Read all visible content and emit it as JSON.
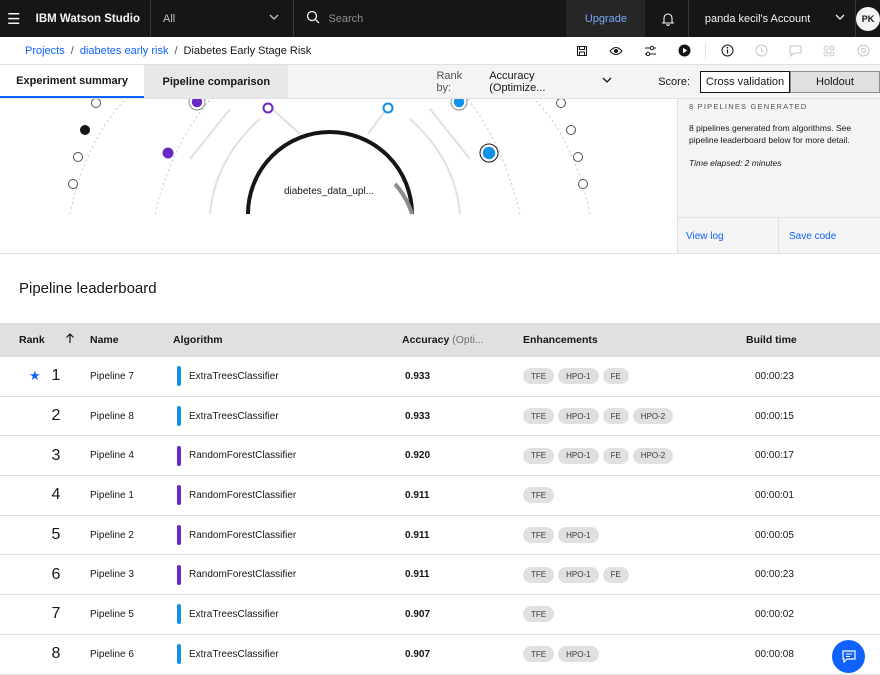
{
  "topbar": {
    "brand": "IBM Watson Studio",
    "scope_value": "All",
    "search_placeholder": "Search",
    "upgrade_label": "Upgrade",
    "account_label": "panda kecil's Account",
    "avatar_initials": "PK"
  },
  "breadcrumb": {
    "items": [
      "Projects",
      "diabetes early risk"
    ],
    "current": "Diabetes Early Stage Risk"
  },
  "tabs": [
    "Experiment summary",
    "Pipeline comparison"
  ],
  "rank_by": {
    "label": "Rank by:",
    "value": "Accuracy (Optimize..."
  },
  "score": {
    "label": "Score:",
    "options": [
      "Cross validation",
      "Holdout"
    ],
    "selected": "Cross validation"
  },
  "viz": {
    "center_label": "diabetes_data_upl..."
  },
  "side_panel": {
    "heading": "8 PIPELINES GENERATED",
    "description": "8 pipelines generated from algorithms. See pipeline leaderboard below for more detail.",
    "elapsed": "Time elapsed: 2 minutes",
    "view_log": "View log",
    "save_code": "Save code"
  },
  "leaderboard": {
    "title": "Pipeline leaderboard",
    "columns": {
      "rank": "Rank",
      "name": "Name",
      "algorithm": "Algorithm",
      "accuracy": "Accuracy",
      "accuracy_suffix": "(Opti...",
      "enhancements": "Enhancements",
      "build_time": "Build time"
    },
    "rows": [
      {
        "rank": "1",
        "name": "Pipeline 7",
        "algorithm": "ExtraTreesClassifier",
        "color": "#1192e8",
        "accuracy": "0.933",
        "enh": [
          "TFE",
          "HPO-1",
          "FE"
        ],
        "time": "00:00:23",
        "star": true
      },
      {
        "rank": "2",
        "name": "Pipeline 8",
        "algorithm": "ExtraTreesClassifier",
        "color": "#1192e8",
        "accuracy": "0.933",
        "enh": [
          "TFE",
          "HPO-1",
          "FE",
          "HPO-2"
        ],
        "time": "00:00:15"
      },
      {
        "rank": "3",
        "name": "Pipeline 4",
        "algorithm": "RandomForestClassifier",
        "color": "#6929c4",
        "accuracy": "0.920",
        "enh": [
          "TFE",
          "HPO-1",
          "FE",
          "HPO-2"
        ],
        "time": "00:00:17"
      },
      {
        "rank": "4",
        "name": "Pipeline 1",
        "algorithm": "RandomForestClassifier",
        "color": "#6929c4",
        "accuracy": "0.911",
        "enh": [
          "TFE"
        ],
        "time": "00:00:01"
      },
      {
        "rank": "5",
        "name": "Pipeline 2",
        "algorithm": "RandomForestClassifier",
        "color": "#6929c4",
        "accuracy": "0.911",
        "enh": [
          "TFE",
          "HPO-1"
        ],
        "time": "00:00:05"
      },
      {
        "rank": "6",
        "name": "Pipeline 3",
        "algorithm": "RandomForestClassifier",
        "color": "#6929c4",
        "accuracy": "0.911",
        "enh": [
          "TFE",
          "HPO-1",
          "FE"
        ],
        "time": "00:00:23"
      },
      {
        "rank": "7",
        "name": "Pipeline 5",
        "algorithm": "ExtraTreesClassifier",
        "color": "#1192e8",
        "accuracy": "0.907",
        "enh": [
          "TFE"
        ],
        "time": "00:00:02"
      },
      {
        "rank": "8",
        "name": "Pipeline 6",
        "algorithm": "ExtraTreesClassifier",
        "color": "#1192e8",
        "accuracy": "0.907",
        "enh": [
          "TFE",
          "HPO-1"
        ],
        "time": "00:00:08"
      }
    ]
  }
}
